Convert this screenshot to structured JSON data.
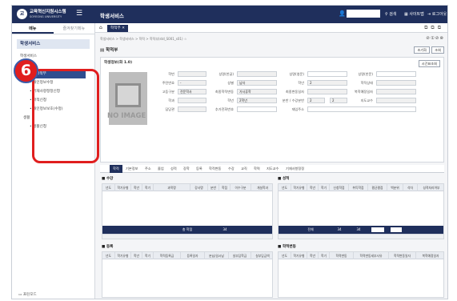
{
  "header": {
    "logo_text": "교",
    "brand": "교육혁신지원시스템",
    "brand_sub": "SOYEONG UNIVERSITY",
    "menu_icon": "hamburger-icon",
    "app_title": "학생서비스",
    "links": [
      "검색",
      "사이트맵",
      "로그아웃"
    ]
  },
  "sidebar": {
    "tabs": [
      "메뉴",
      "즐겨찾기메뉴"
    ],
    "section": "학생서비스",
    "tree": [
      {
        "label": "학생서비스",
        "level": 0
      },
      {
        "label": "학적",
        "level": 1
      },
      {
        "label": "• 학적부",
        "level": 2,
        "active": true
      },
      {
        "label": "• 개인정보수정",
        "level": 2
      },
      {
        "label": "• 기재사항정정신청",
        "level": 2
      },
      {
        "label": "• 학적신청",
        "level": 2
      },
      {
        "label": "• 개인정보보호(수정)",
        "level": 2
      },
      {
        "label": "생활",
        "level": 1
      },
      {
        "label": "• 생활신청",
        "level": 2
      }
    ],
    "callout_number": "6",
    "bottom": "프린모드"
  },
  "main": {
    "tab_label": "학적부",
    "tab_close": "✕",
    "window_icons": "⧉⧉⧉",
    "breadcrumb": "학생서비스 > 학생서비스 > 학적 > 학적부(std_S001_s01) ☆",
    "breadcrumb_controls": "⊘①⊘⊗",
    "page_title": "학적부",
    "btn_new": "초기화",
    "btn_search": "조회",
    "panel_title": "학생정보(화 1.0)",
    "btn_time": "시간표조회",
    "photo_label": "NO IMAGE",
    "fields": [
      {
        "label": "학번",
        "value": ""
      },
      {
        "label": "성명(한글)",
        "value": ""
      },
      {
        "label": "성명(영문)",
        "value": ""
      },
      {
        "label": "성명(한문)",
        "value": ""
      },
      {
        "label": "주민번호",
        "value": "-"
      },
      {
        "label": "성별",
        "value": "남자"
      },
      {
        "label": "학년",
        "value": "2"
      },
      {
        "label": "학적상태",
        "value": ""
      },
      {
        "label": "고등구분",
        "value": "전문학사"
      },
      {
        "label": "최종학적변동",
        "value": "가사휴학"
      },
      {
        "label": "최종변동일자",
        "value": ""
      },
      {
        "label": "복학예정일자",
        "value": ""
      },
      {
        "label": "학과",
        "value": ""
      },
      {
        "label": "학년",
        "value": "2학년"
      },
      {
        "label": "분반 / 수강분반",
        "value": "2"
      },
      {
        "label": "지도교수",
        "value": ""
      },
      {
        "label": "담당관",
        "value": ""
      },
      {
        "label": "추가전화번호",
        "value": ""
      },
      {
        "label": "재입주소",
        "value": ""
      }
    ],
    "subtabs": [
      "학적",
      "기본정보",
      "주소",
      "졸업",
      "성적",
      "장학",
      "등록",
      "학적변동",
      "수강",
      "교직",
      "학력",
      "지도교수",
      "기재사항정정"
    ],
    "grids": {
      "suk": {
        "title": "수강",
        "cols": [
          "년도",
          "학기유형",
          "학년",
          "학기",
          "과목명",
          "강사명",
          "분반",
          "학점",
          "이수구분",
          "개설학과"
        ],
        "foot_label": "총 학점",
        "foot_value": "34"
      },
      "seong": {
        "title": "성적",
        "cols": [
          "년도",
          "학기유형",
          "학년",
          "학기",
          "신청학점",
          "취득학점",
          "평균평점",
          "백분위",
          "석차",
          "성적처리여부"
        ],
        "foot_label": "전체",
        "foot_values": [
          "34",
          "34"
        ]
      },
      "deung": {
        "title": "등록",
        "cols": [
          "년도",
          "학기유형",
          "학년",
          "학기",
          "학적등록금",
          "등록일자",
          "분납/일시납",
          "실부담학금",
          "실부담금액"
        ]
      },
      "hakjuk": {
        "title": "학적변동",
        "cols": [
          "년도",
          "학기유형",
          "학년",
          "학기",
          "학적변동",
          "학적변동세부사유",
          "학적변동일자",
          "복학예정일자"
        ]
      }
    }
  }
}
